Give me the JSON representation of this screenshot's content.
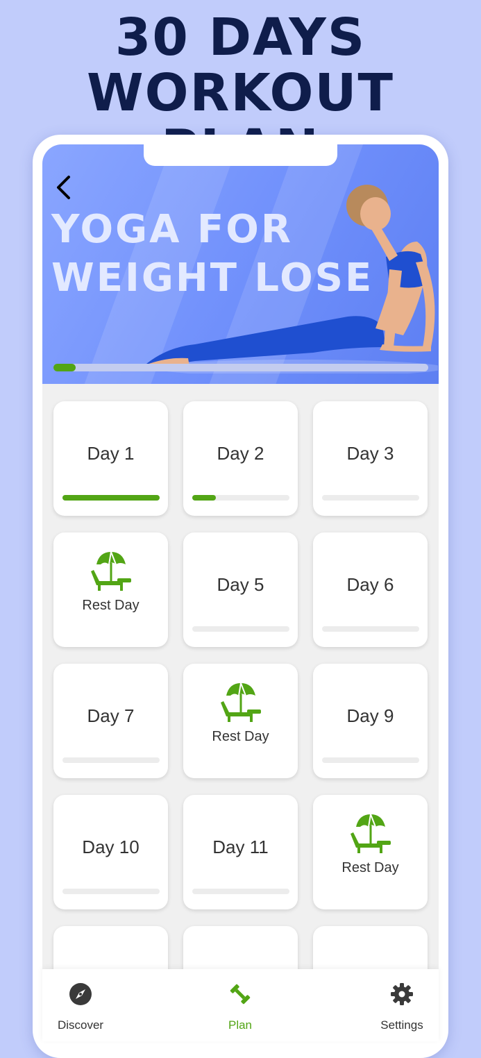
{
  "promo": {
    "line1": "30 DAYS",
    "line2": "WORKOUT PLAN"
  },
  "hero": {
    "title_line1": "YOGA FOR",
    "title_line2": "WEIGHT LOSE",
    "progress": 0.06,
    "colors": {
      "accent": "#52a515",
      "hero": "#7391fb"
    }
  },
  "days": [
    {
      "type": "day",
      "label": "Day 1",
      "progress": 1.0
    },
    {
      "type": "day",
      "label": "Day 2",
      "progress": 0.24
    },
    {
      "type": "day",
      "label": "Day 3",
      "progress": 0.0
    },
    {
      "type": "rest",
      "label": "Rest Day",
      "icon": "beach-umbrella-icon"
    },
    {
      "type": "day",
      "label": "Day 5",
      "progress": 0.0
    },
    {
      "type": "day",
      "label": "Day 6",
      "progress": 0.0
    },
    {
      "type": "day",
      "label": "Day 7",
      "progress": 0.0
    },
    {
      "type": "rest",
      "label": "Rest Day",
      "icon": "beach-umbrella-icon"
    },
    {
      "type": "day",
      "label": "Day 9",
      "progress": 0.0
    },
    {
      "type": "day",
      "label": "Day 10",
      "progress": 0.0
    },
    {
      "type": "day",
      "label": "Day 11",
      "progress": 0.0
    },
    {
      "type": "rest",
      "label": "Rest Day",
      "icon": "beach-umbrella-icon"
    }
  ],
  "nav": {
    "items": [
      {
        "label": "Discover",
        "icon": "compass-icon",
        "active": false
      },
      {
        "label": "Plan",
        "icon": "dumbbell-icon",
        "active": true
      },
      {
        "label": "Settings",
        "icon": "gear-icon",
        "active": false
      }
    ]
  }
}
